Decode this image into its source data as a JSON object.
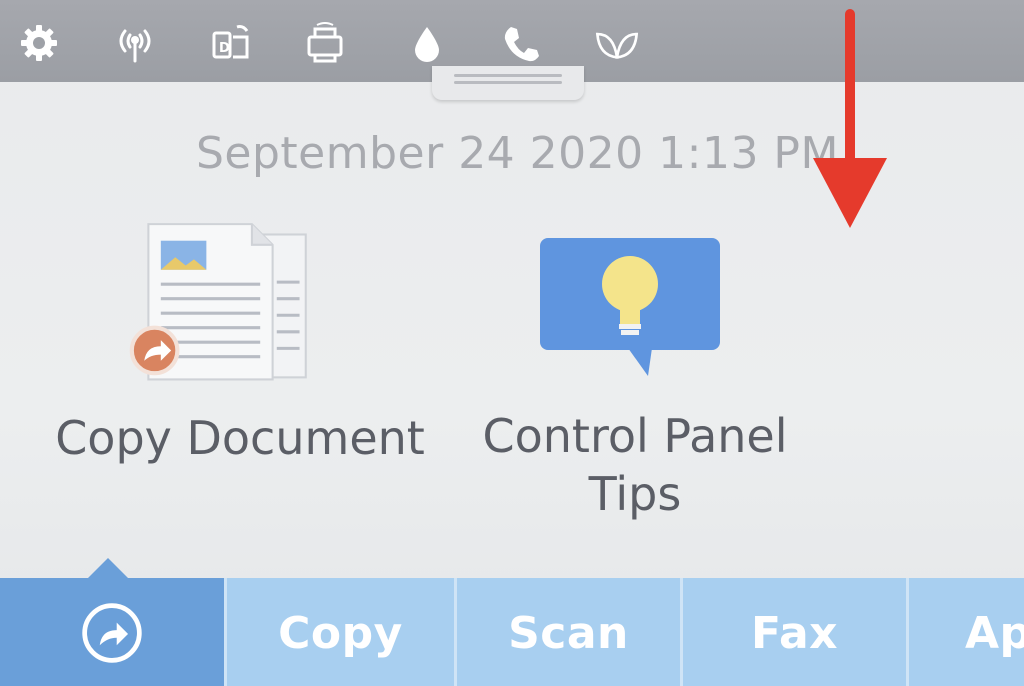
{
  "status_bar": {
    "icons": [
      "settings-icon",
      "wireless-signal-icon",
      "wifi-direct-icon",
      "web-services-icon",
      "ink-icon",
      "fax-icon",
      "eco-icon"
    ]
  },
  "datetime": "September 24 2020 1:13 PM",
  "tiles": [
    {
      "label": "Copy Document",
      "icon": "copy-document-icon"
    },
    {
      "label_line1": "Control Panel",
      "label_line2": "Tips",
      "icon": "lightbulb-icon"
    }
  ],
  "tabs": [
    {
      "label": "",
      "icon": "shortcut-icon",
      "active": true
    },
    {
      "label": "Copy"
    },
    {
      "label": "Scan"
    },
    {
      "label": "Fax"
    },
    {
      "label": "Ap"
    }
  ],
  "colors": {
    "topbar": "#9ea1a7",
    "tab_active": "#6a9fd9",
    "tab": "#a8cff0",
    "annotation_arrow": "#e53a2c",
    "tips_bubble": "#5f95df"
  }
}
